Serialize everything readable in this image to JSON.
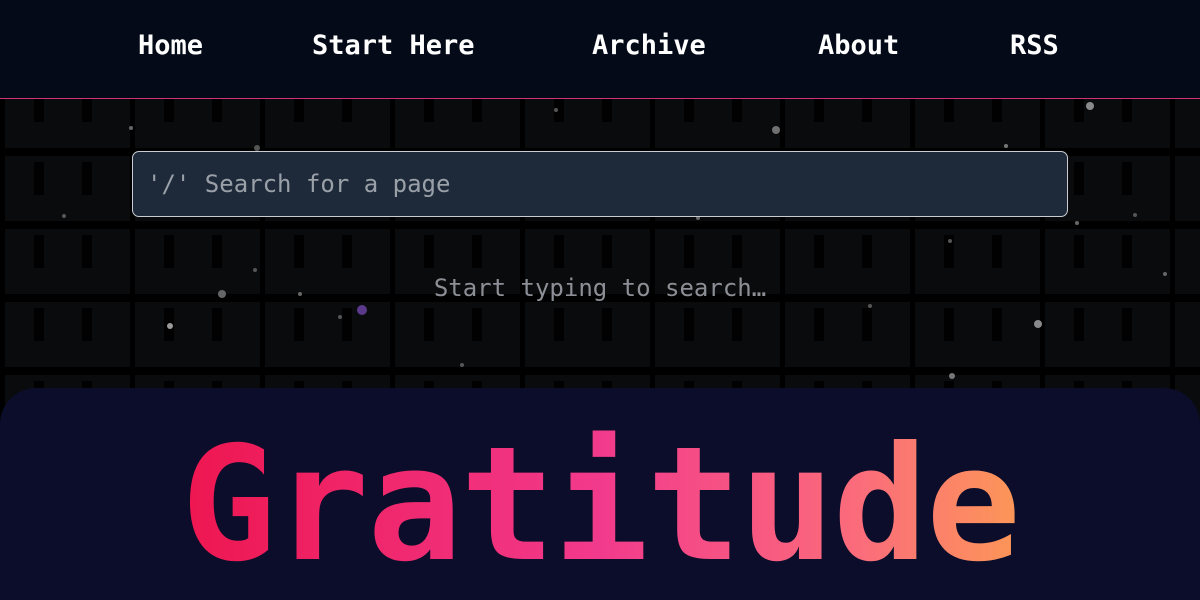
{
  "nav": {
    "items": [
      {
        "label": "Home"
      },
      {
        "label": "Start Here"
      },
      {
        "label": "Archive"
      },
      {
        "label": "About"
      },
      {
        "label": "RSS"
      }
    ]
  },
  "search": {
    "placeholder": "'/' Search for a page",
    "value": "",
    "hint": "Start typing to search…"
  },
  "post": {
    "title": "Gratitude"
  },
  "colors": {
    "nav_background": "#050a18",
    "nav_border": "#d4307a",
    "search_background": "#1e2a3a",
    "card_background": "#0b0d2a",
    "title_gradient_start": "#ee1650",
    "title_gradient_mid": "#f23a8c",
    "title_gradient_end": "#fca14f"
  }
}
